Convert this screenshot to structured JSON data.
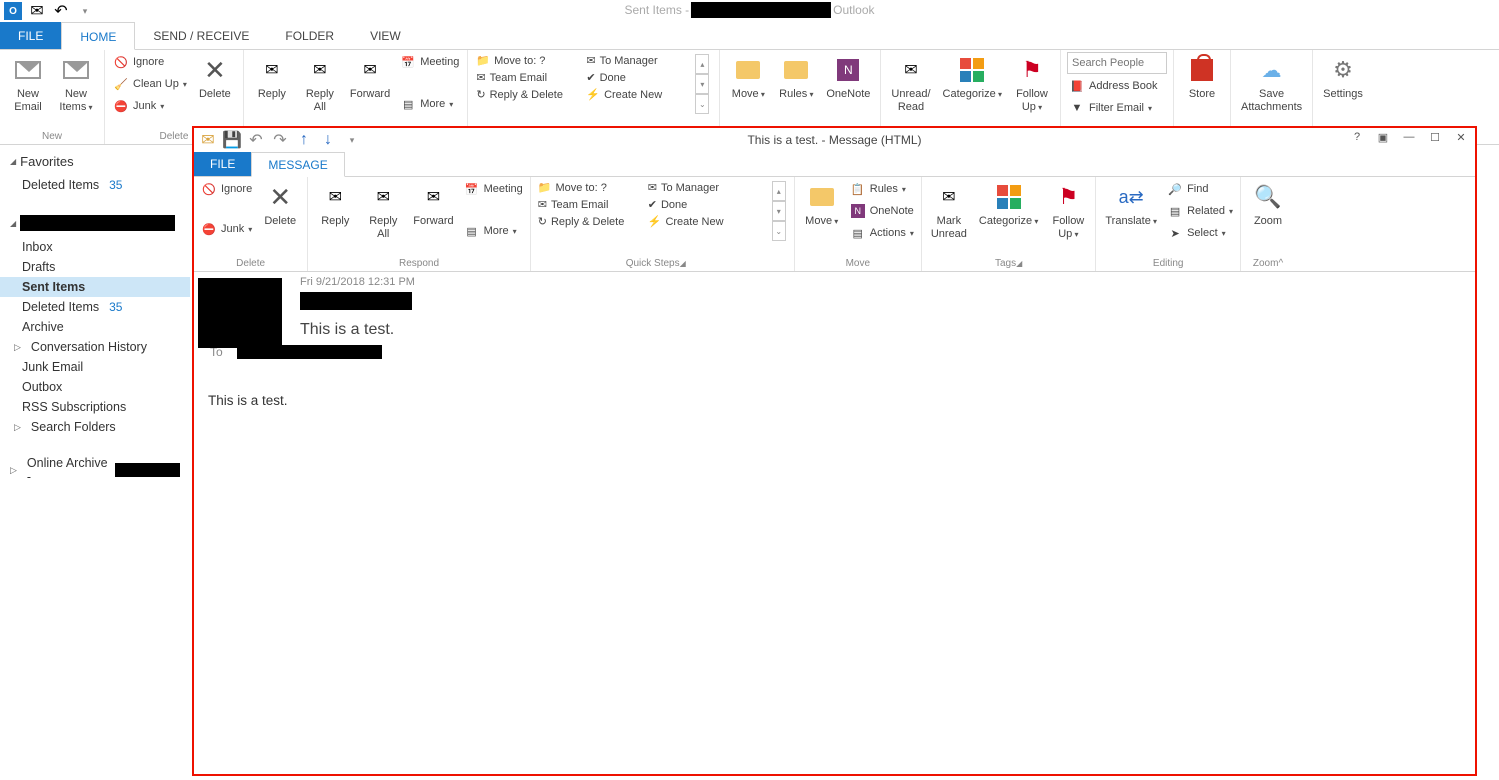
{
  "app": {
    "title_prefix": "Sent Items - ",
    "title_suffix": " Outlook"
  },
  "main_tabs": {
    "file": "FILE",
    "home": "HOME",
    "send_receive": "SEND / RECEIVE",
    "folder": "FOLDER",
    "view": "VIEW"
  },
  "ribbon": {
    "new": {
      "new_email": "New\nEmail",
      "new_items": "New\nItems",
      "label": "New"
    },
    "delete": {
      "ignore": "Ignore",
      "cleanup": "Clean Up",
      "junk": "Junk",
      "delete": "Delete",
      "label": "Delete"
    },
    "respond": {
      "reply": "Reply",
      "reply_all": "Reply\nAll",
      "forward": "Forward",
      "meeting": "Meeting",
      "more": "More"
    },
    "quicksteps": {
      "move_to": "Move to: ?",
      "to_manager": "To Manager",
      "team_email": "Team Email",
      "done": "Done",
      "reply_delete": "Reply & Delete",
      "create_new": "Create New"
    },
    "move": {
      "move": "Move",
      "rules": "Rules",
      "onenote": "OneNote"
    },
    "tags": {
      "unread_read": "Unread/\nRead",
      "categorize": "Categorize",
      "followup": "Follow\nUp"
    },
    "find": {
      "search_placeholder": "Search People",
      "address_book": "Address Book",
      "filter_email": "Filter Email"
    },
    "store": "Store",
    "save_attachments": "Save\nAttachments",
    "settings": "Settings"
  },
  "folders": {
    "favorites": "Favorites",
    "deleted_items": "Deleted Items",
    "deleted_count": "35",
    "inbox": "Inbox",
    "drafts": "Drafts",
    "sent_items": "Sent Items",
    "archive": "Archive",
    "conversation_history": "Conversation History",
    "junk_email": "Junk Email",
    "outbox": "Outbox",
    "rss": "RSS Subscriptions",
    "search_folders": "Search Folders",
    "online_archive": "Online Archive - "
  },
  "msg_window": {
    "title": "This is a test. - Message (HTML)",
    "tabs": {
      "file": "FILE",
      "message": "MESSAGE"
    },
    "ribbon": {
      "ignore": "Ignore",
      "junk": "Junk",
      "delete": "Delete",
      "reply": "Reply",
      "reply_all": "Reply\nAll",
      "forward": "Forward",
      "meeting": "Meeting",
      "more": "More",
      "move_to": "Move to: ?",
      "to_manager": "To Manager",
      "team_email": "Team Email",
      "done": "Done",
      "reply_delete": "Reply & Delete",
      "create_new": "Create New",
      "move": "Move",
      "rules": "Rules",
      "onenote": "OneNote",
      "actions": "Actions",
      "mark_unread": "Mark\nUnread",
      "categorize": "Categorize",
      "followup": "Follow\nUp",
      "translate": "Translate",
      "find": "Find",
      "related": "Related",
      "select": "Select",
      "zoom": "Zoom",
      "label_delete": "Delete",
      "label_respond": "Respond",
      "label_quicksteps": "Quick Steps",
      "label_move": "Move",
      "label_tags": "Tags",
      "label_editing": "Editing",
      "label_zoom": "Zoom"
    },
    "date": "Fri 9/21/2018 12:31 PM",
    "subject": "This is a test.",
    "to_label": "To",
    "body": "This is a test."
  }
}
